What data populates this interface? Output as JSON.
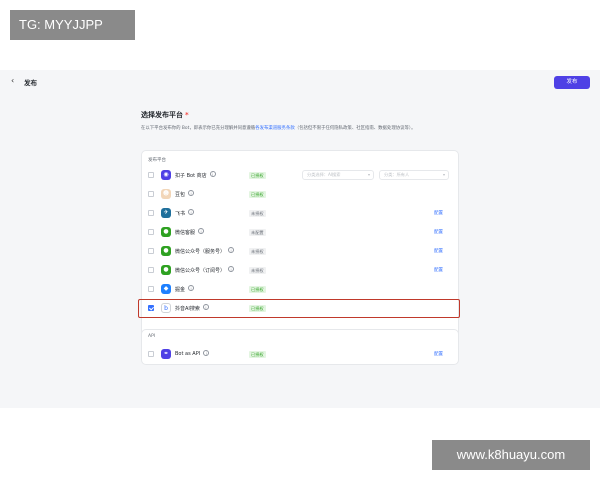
{
  "watermark": {
    "top_left": "TG: MYYJJPP",
    "bottom_right": "www.k8huayu.com"
  },
  "header": {
    "back_icon": "‹",
    "title": "发布",
    "publish_label": "发布"
  },
  "main": {
    "heading": "选择发布平台",
    "required_mark": "*",
    "desc_prefix": "在以下平台发布你的 Bot，即表示你已充分理解并同意遵循",
    "desc_link": "各发布渠道服务条款",
    "desc_suffix": "（包括但不限于任何隐私政策、社区指南、数据处理协议等）。"
  },
  "section1_title": "发布平台",
  "platforms": [
    {
      "name": "扣子 Bot 商店",
      "status": "已授权",
      "status_type": "ok",
      "checked": false,
      "icon": "bot-store-icon",
      "color": "#4e40e5",
      "glyph": "◉",
      "action": "",
      "has_selects": true
    },
    {
      "name": "豆包",
      "status": "已授权",
      "status_type": "ok",
      "checked": false,
      "icon": "doubao-icon",
      "color": "#f2d6b8",
      "glyph": "☻",
      "action": ""
    },
    {
      "name": "飞书",
      "status": "未授权",
      "status_type": "no",
      "checked": false,
      "icon": "feishu-icon",
      "color": "#1f6f9b",
      "glyph": "✈",
      "action": "配置"
    },
    {
      "name": "微信客服",
      "status": "未配置",
      "status_type": "no",
      "checked": false,
      "icon": "wechat-service-icon",
      "color": "#2ea121",
      "glyph": "●",
      "action": "配置"
    },
    {
      "name": "微信公众号（服务号）",
      "status": "未授权",
      "status_type": "no",
      "checked": false,
      "icon": "wechat-service-account-icon",
      "color": "#2ea121",
      "glyph": "●",
      "action": "配置"
    },
    {
      "name": "微信公众号（订阅号）",
      "status": "未授权",
      "status_type": "no",
      "checked": false,
      "icon": "wechat-subscription-icon",
      "color": "#2ea121",
      "glyph": "●",
      "action": "配置"
    },
    {
      "name": "掘金",
      "status": "已授权",
      "status_type": "ok",
      "checked": false,
      "icon": "juejin-icon",
      "color": "#1e80ff",
      "glyph": "◆",
      "action": ""
    },
    {
      "name": "抖音AI搜索",
      "status": "已授权",
      "status_type": "ok",
      "checked": true,
      "icon": "douyin-ai-search-icon",
      "color": "#ffffff",
      "glyph": "b",
      "action": ""
    }
  ],
  "selects": {
    "category_placeholder": "分类选择：AI搜索",
    "visibility_placeholder": "分类：所有人"
  },
  "section2_title": "API",
  "api_row": {
    "name": "Bot as API",
    "status": "已授权",
    "status_type": "ok",
    "checked": false,
    "icon": "api-icon",
    "color": "#4e40e5",
    "glyph": "⚭",
    "action": "配置"
  },
  "colors": {
    "accent": "#4e40e5",
    "link": "#3370ff",
    "highlight": "#c0392b"
  }
}
